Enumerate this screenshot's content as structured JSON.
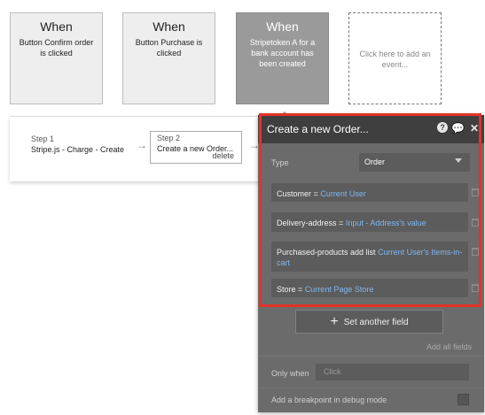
{
  "events": [
    {
      "title": "When",
      "desc_lines": [
        "Button Confirm order",
        "is clicked"
      ]
    },
    {
      "title": "When",
      "desc_lines": [
        "Button Purchase is",
        "clicked"
      ]
    },
    {
      "title": "When",
      "desc_lines": [
        "Stripetoken A for a",
        "bank account has",
        "been created"
      ]
    }
  ],
  "add_event_lines": [
    "Click here to add an",
    "event..."
  ],
  "steps": [
    {
      "label": "Step 1",
      "name": "Stripe.js - Charge - Create"
    },
    {
      "label": "Step 2",
      "name": "Create a new Order...",
      "delete_label": "delete"
    }
  ],
  "arrow_glyph": "→",
  "panel": {
    "title": "Create a new Order...",
    "help_glyph": "?",
    "comment_glyph": "💬",
    "close_glyph": "✕",
    "type_label": "Type",
    "type_value": "Order",
    "fields": [
      {
        "name": "Customer",
        "op": "=",
        "value": "Current User"
      },
      {
        "name": "Delivery-address",
        "op": "=",
        "value": "Input - Address's value"
      },
      {
        "name": "Purchased-products add list",
        "op": "",
        "value": "Current User's Items-in-cart"
      },
      {
        "name": "Store",
        "op": "=",
        "value": "Current Page Store"
      }
    ],
    "set_another_label": "Set another field",
    "plus_glyph": "+",
    "add_all_label": "Add all fields",
    "only_when_label": "Only when",
    "only_when_placeholder": "Click",
    "breakpoint_label": "Add a breakpoint in debug mode"
  },
  "colors": {
    "highlight": "#e53128",
    "link": "#7fb7f0",
    "panel_bg": "#6b6b6b",
    "header_bg": "#3f3f3f"
  }
}
